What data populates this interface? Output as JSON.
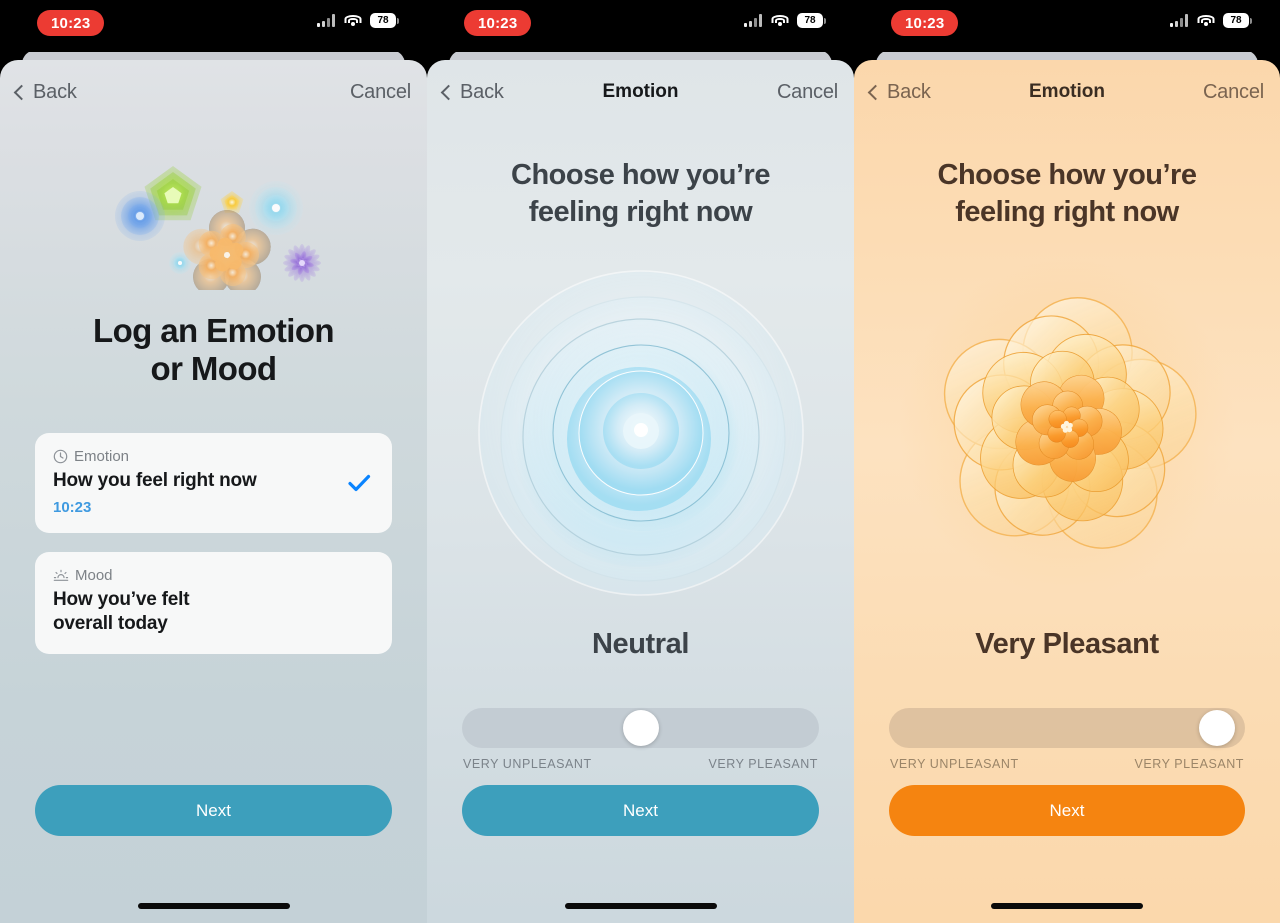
{
  "status_bar": {
    "time": "10:23",
    "battery_level": "78",
    "cellular_icon": "cellular-bars-icon",
    "wifi_icon": "wifi-icon",
    "battery_icon": "battery-icon"
  },
  "colors": {
    "accent_teal": "#3d9fbc",
    "accent_orange": "#f58410",
    "link_blue": "#3f9ae0",
    "time_pill_red": "#ec3b33",
    "check_blue": "#0a84ff"
  },
  "screens": [
    {
      "id": "log-chooser",
      "nav": {
        "back_label": "Back",
        "title": "",
        "cancel_label": "Cancel",
        "back_icon": "chevron-left-icon"
      },
      "art": "emotion-cluster-illustration",
      "title": "Log an Emotion\nor Mood",
      "title_line1": "Log an Emotion",
      "title_line2": "or Mood",
      "cards": [
        {
          "kicker": "Emotion",
          "kicker_icon": "clock-icon",
          "main": "How you feel right now",
          "time": "10:23",
          "selected": true,
          "check_icon": "checkmark-icon"
        },
        {
          "kicker": "Mood",
          "kicker_icon": "sunrise-icon",
          "main": "How you’ve felt\noverall today",
          "main_line1": "How you’ve felt",
          "main_line2": "overall today",
          "time": "",
          "selected": false
        }
      ],
      "next_label": "Next",
      "next_color": "#3d9fbc"
    },
    {
      "id": "emotion-neutral",
      "nav": {
        "back_label": "Back",
        "title": "Emotion",
        "cancel_label": "Cancel",
        "back_icon": "chevron-left-icon"
      },
      "question_line1": "Choose how you’re",
      "question_line2": "feeling right now",
      "art": "neutral-rings-illustration",
      "state_label": "Neutral",
      "slider": {
        "value_percent": 50,
        "min_label": "VERY UNPLEASANT",
        "max_label": "VERY PLEASANT"
      },
      "next_label": "Next",
      "next_color": "#3d9fbc"
    },
    {
      "id": "emotion-very-pleasant",
      "nav": {
        "back_label": "Back",
        "title": "Emotion",
        "cancel_label": "Cancel",
        "back_icon": "chevron-left-icon"
      },
      "question_line1": "Choose how you’re",
      "question_line2": "feeling right now",
      "art": "very-pleasant-flower-illustration",
      "state_label": "Very Pleasant",
      "slider": {
        "value_percent": 92,
        "min_label": "VERY UNPLEASANT",
        "max_label": "VERY PLEASANT"
      },
      "next_label": "Next",
      "next_color": "#f58410"
    }
  ]
}
